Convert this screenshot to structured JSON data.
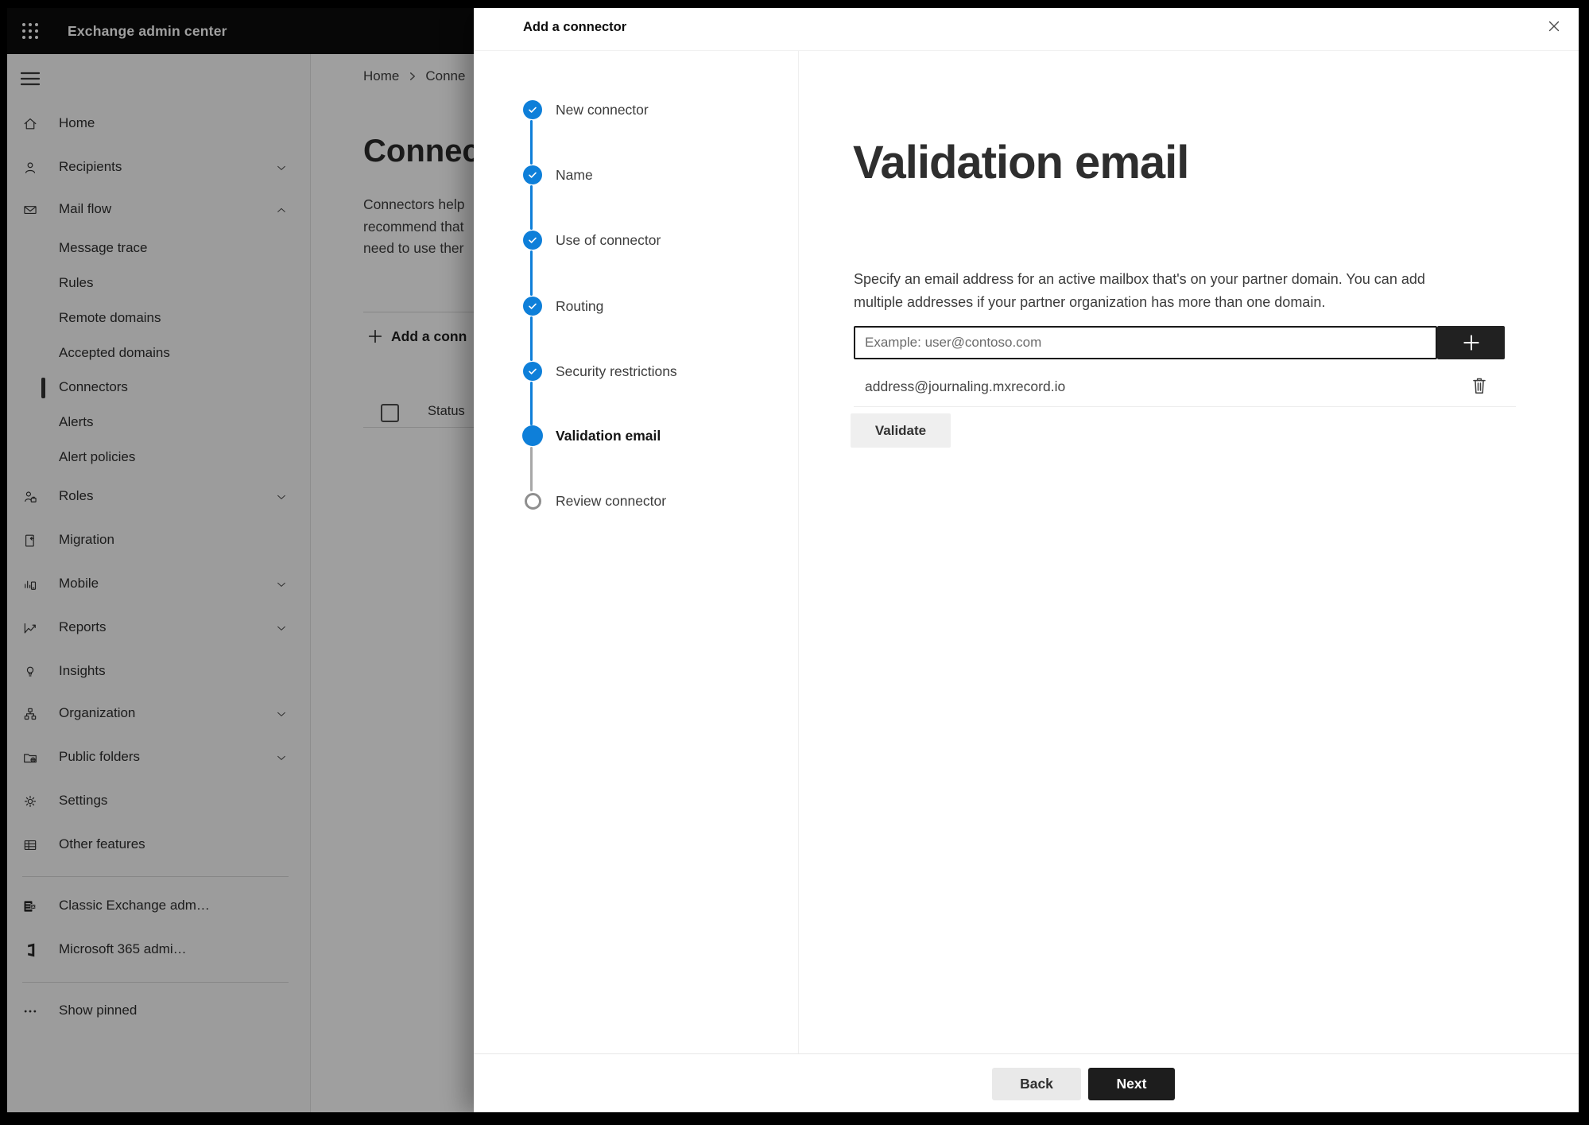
{
  "topbar": {
    "app_title": "Exchange admin center"
  },
  "sidebar": {
    "items": [
      {
        "label": "Home"
      },
      {
        "label": "Recipients"
      },
      {
        "label": "Mail flow"
      },
      {
        "label": "Message trace"
      },
      {
        "label": "Rules"
      },
      {
        "label": "Remote domains"
      },
      {
        "label": "Accepted domains"
      },
      {
        "label": "Connectors",
        "selected": true
      },
      {
        "label": "Alerts"
      },
      {
        "label": "Alert policies"
      },
      {
        "label": "Roles"
      },
      {
        "label": "Migration"
      },
      {
        "label": "Mobile"
      },
      {
        "label": "Reports"
      },
      {
        "label": "Insights"
      },
      {
        "label": "Organization"
      },
      {
        "label": "Public folders"
      },
      {
        "label": "Settings"
      },
      {
        "label": "Other features"
      },
      {
        "label": "Classic Exchange adm…"
      },
      {
        "label": "Microsoft 365 admi…"
      },
      {
        "label": "Show pinned"
      }
    ]
  },
  "page": {
    "breadcrumb": {
      "home": "Home",
      "current": "Conne"
    },
    "heading": "Connec",
    "description_lines": [
      "Connectors help",
      "recommend that",
      "need to use ther"
    ],
    "add_button_label": "Add a conn",
    "table": {
      "status_column": "Status"
    }
  },
  "panel": {
    "title": "Add a connector",
    "steps": [
      {
        "label": "New connector",
        "state": "complete"
      },
      {
        "label": "Name",
        "state": "complete"
      },
      {
        "label": "Use of connector",
        "state": "complete"
      },
      {
        "label": "Routing",
        "state": "complete"
      },
      {
        "label": "Security restrictions",
        "state": "complete"
      },
      {
        "label": "Validation email",
        "state": "current"
      },
      {
        "label": "Review connector",
        "state": "upcoming"
      }
    ],
    "content": {
      "heading": "Validation email",
      "description_lines": [
        "Specify an email address for an active mailbox that's on your partner domain. You can add",
        "multiple addresses if your partner organization has more than one domain."
      ],
      "email_input": {
        "placeholder": "Example: user@contoso.com",
        "value": ""
      },
      "addresses": [
        "address@journaling.mxrecord.io"
      ],
      "validate_button": "Validate"
    },
    "footer": {
      "back_label": "Back",
      "next_label": "Next"
    }
  },
  "colors": {
    "accent_blue": "#0e7fd9",
    "primary_button": "#1d1d1d",
    "topbar_bg": "#0c0c0c",
    "step_upcoming_ring": "#8f8f8f"
  }
}
